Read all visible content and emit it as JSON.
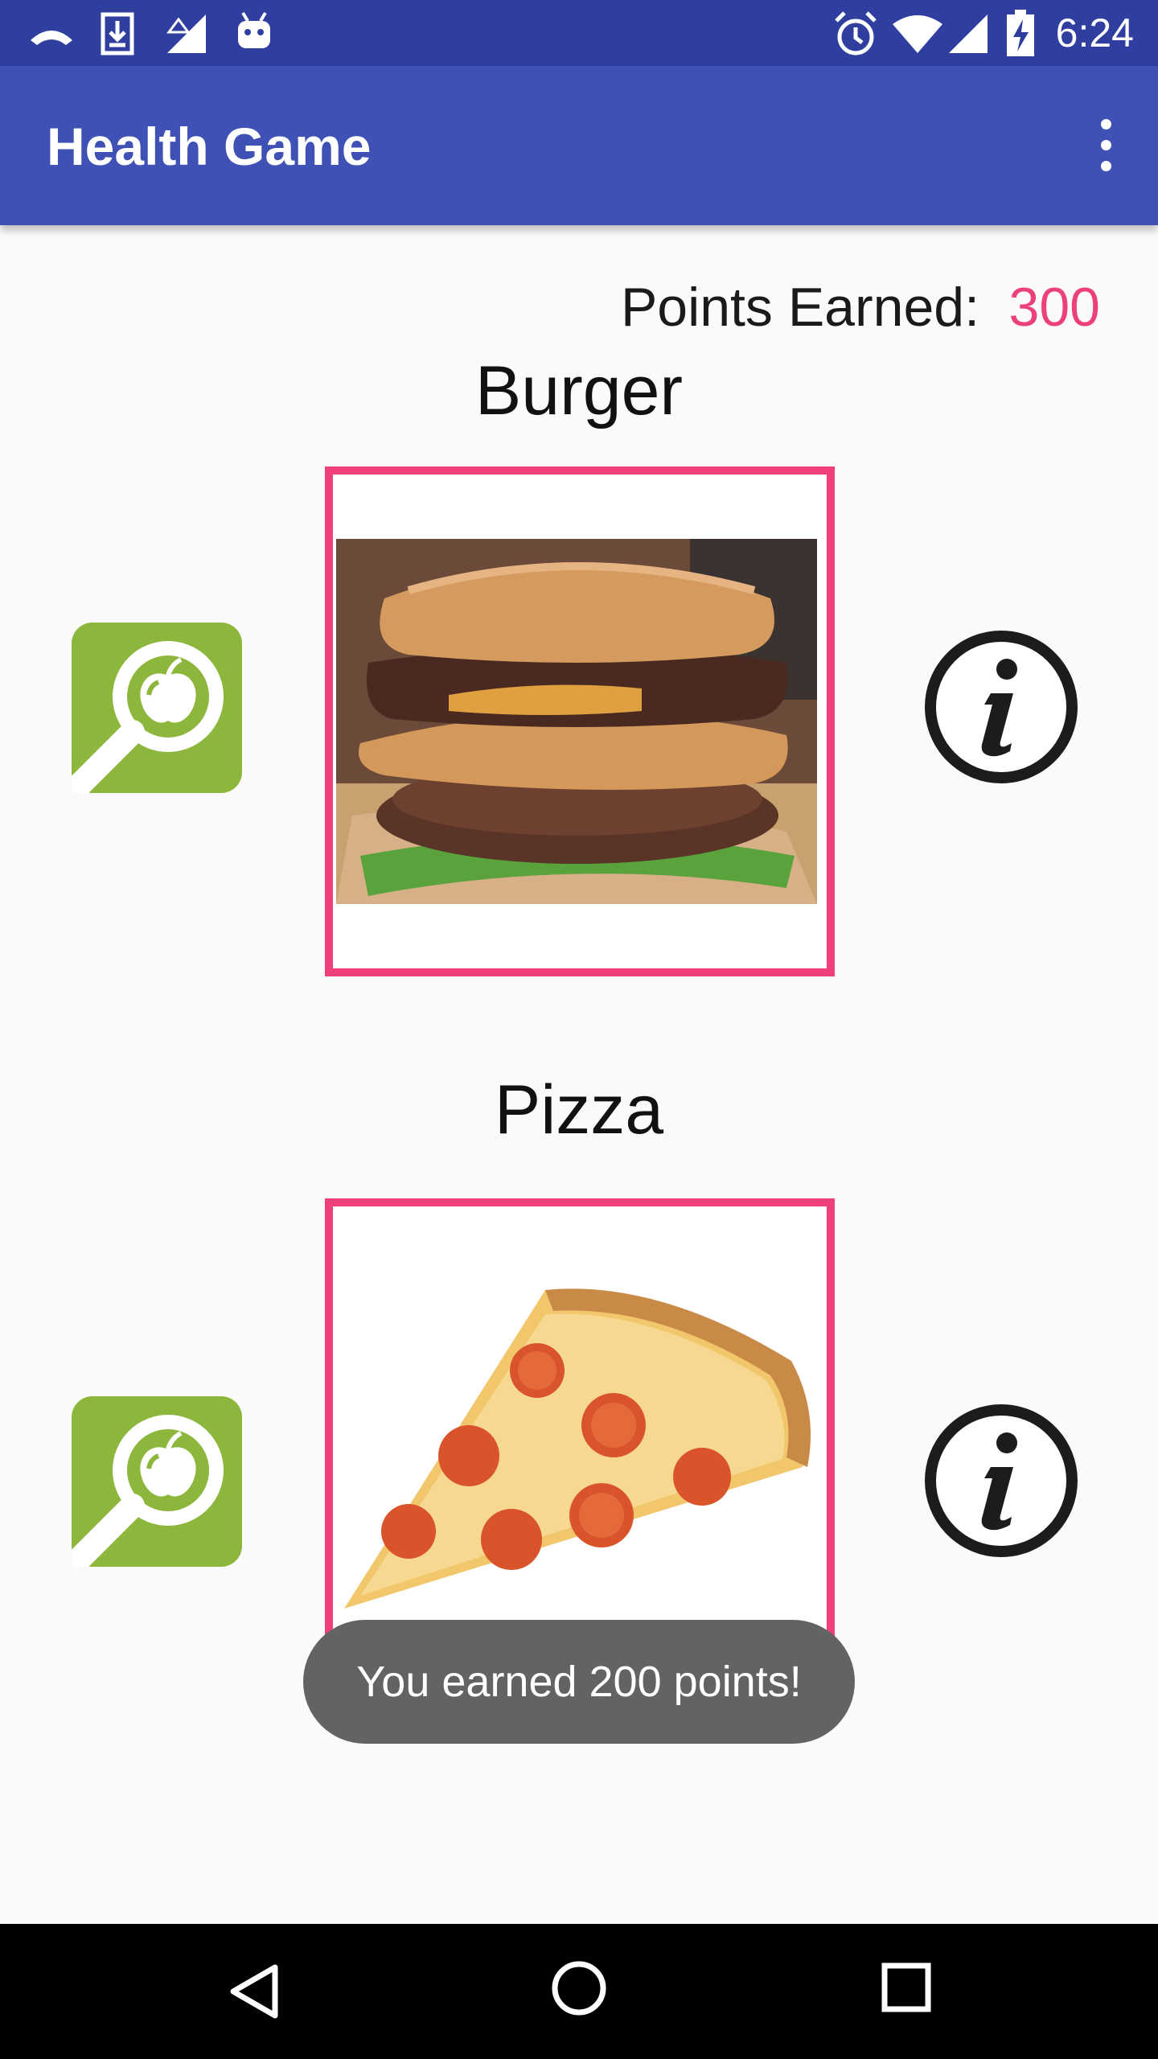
{
  "status_bar": {
    "time": "6:24",
    "left_icons": [
      "phone-icon",
      "download-icon",
      "signal-outline-icon",
      "android-icon"
    ],
    "right_icons": [
      "alarm-icon",
      "wifi-icon",
      "cell-signal-icon",
      "battery-charging-icon"
    ]
  },
  "app_bar": {
    "title": "Health Game",
    "menu_icon": "overflow-menu-icon"
  },
  "points": {
    "label": "Points Earned:",
    "value": "300",
    "value_color": "#ec407a"
  },
  "foods": [
    {
      "name": "Burger",
      "search_icon": "apple-search-icon",
      "info_icon": "info-icon"
    },
    {
      "name": "Pizza",
      "search_icon": "apple-search-icon",
      "info_icon": "info-icon"
    }
  ],
  "toast": {
    "message": "You earned 200 points!"
  },
  "nav_bar": {
    "icons": [
      "back-icon",
      "home-icon",
      "recents-icon"
    ]
  },
  "colors": {
    "status_bar": "#303f9f",
    "app_bar": "#3f51b5",
    "accent": "#f0407b",
    "search_tile": "#8db73c"
  }
}
